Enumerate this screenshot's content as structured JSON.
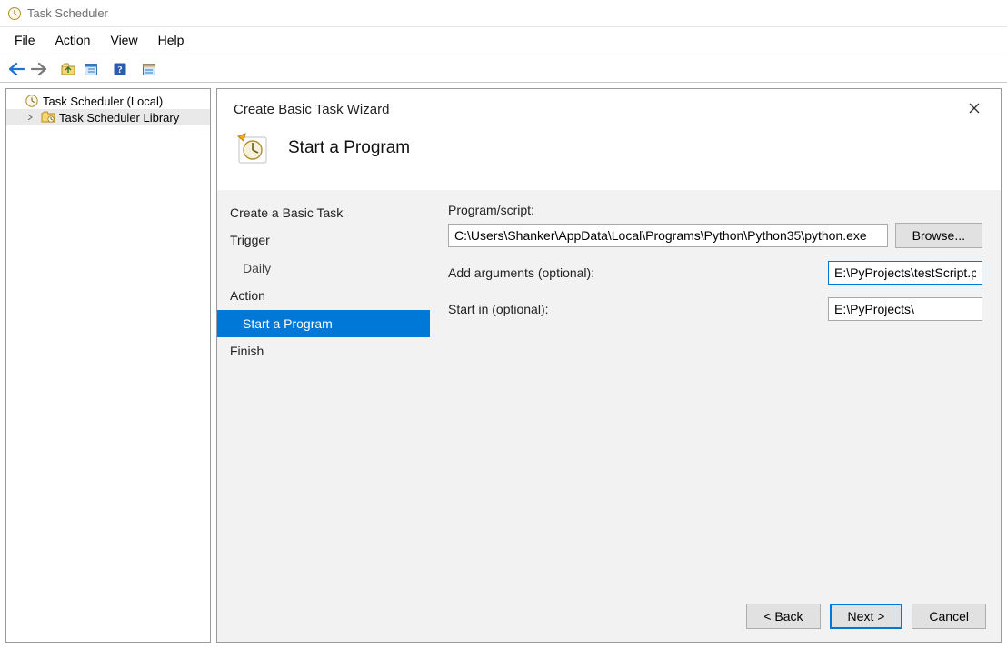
{
  "window": {
    "title": "Task Scheduler"
  },
  "menubar": {
    "file": "File",
    "action": "Action",
    "view": "View",
    "help": "Help"
  },
  "tree": {
    "root": "Task Scheduler (Local)",
    "library": "Task Scheduler Library"
  },
  "wizard": {
    "title": "Create Basic Task Wizard",
    "heading": "Start a Program",
    "nav": {
      "create": "Create a Basic Task",
      "trigger": "Trigger",
      "trigger_sub": "Daily",
      "action": "Action",
      "action_sub": "Start a Program",
      "finish": "Finish"
    },
    "form": {
      "program_label": "Program/script:",
      "program_value": "C:\\Users\\Shanker\\AppData\\Local\\Programs\\Python\\Python35\\python.exe",
      "browse": "Browse...",
      "args_label": "Add arguments (optional):",
      "args_value": "E:\\PyProjects\\testScript.py",
      "startin_label": "Start in (optional):",
      "startin_value": "E:\\PyProjects\\"
    },
    "buttons": {
      "back": "< Back",
      "next": "Next >",
      "cancel": "Cancel"
    }
  }
}
